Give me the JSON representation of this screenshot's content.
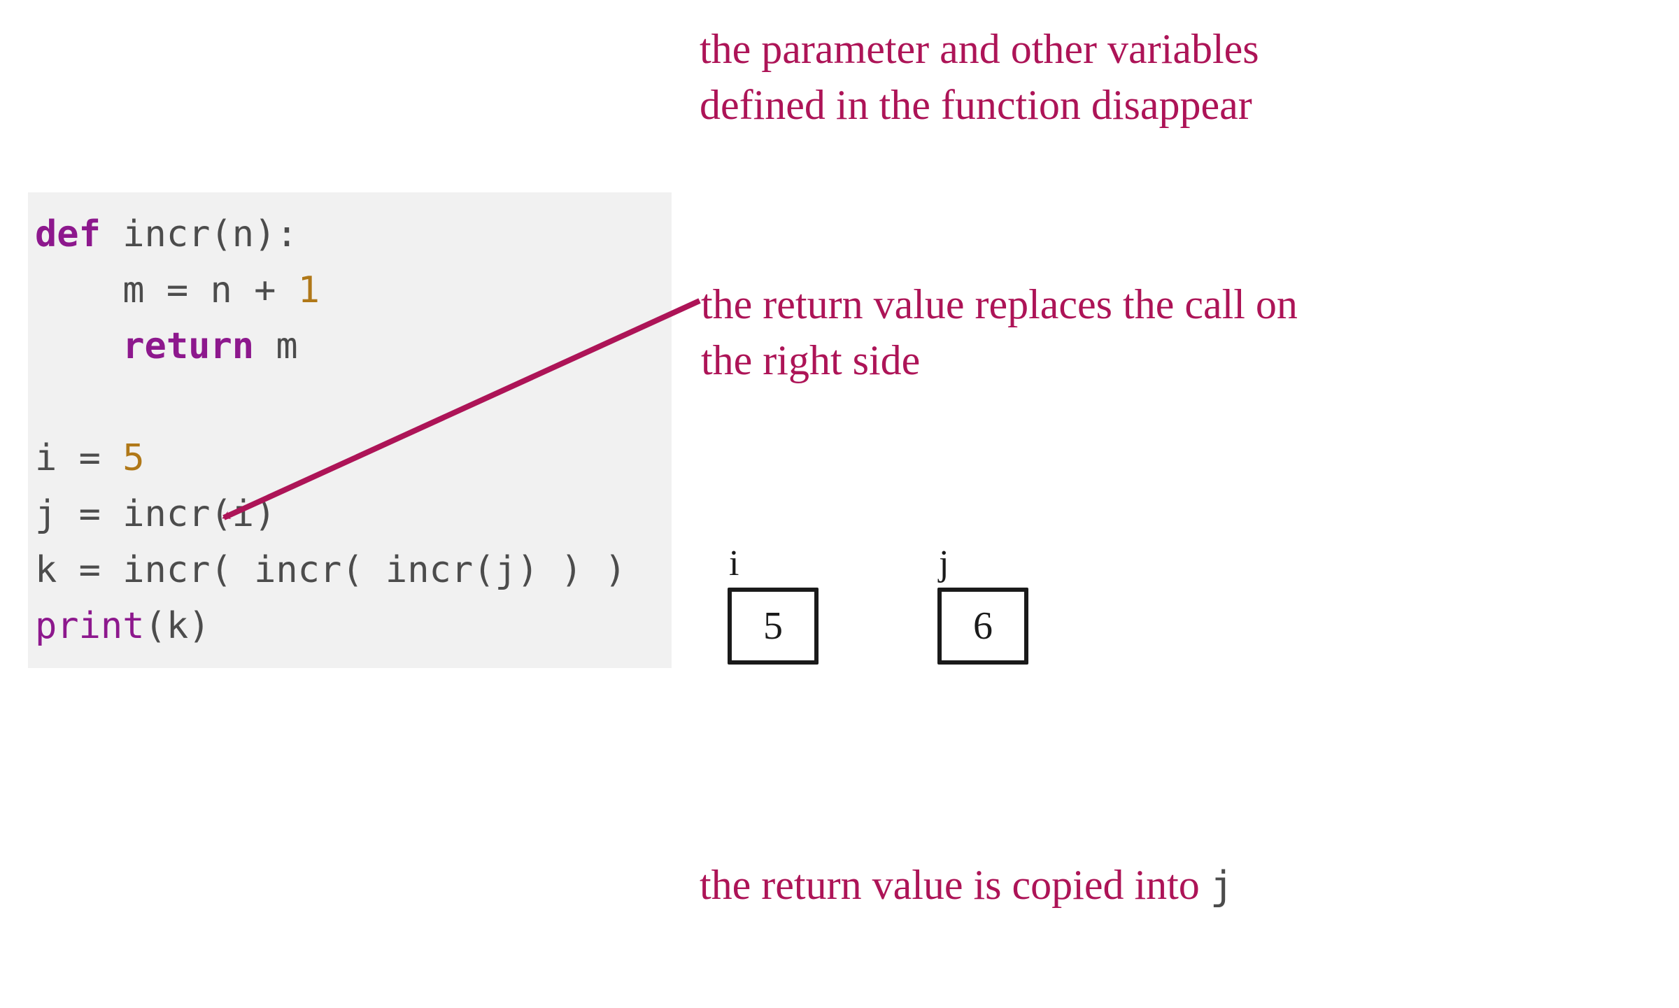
{
  "code": {
    "lines": [
      {
        "html": "<span class='t-def'>def</span> incr(n):"
      },
      {
        "html": "    m = n + <span class='t-num'>1</span>"
      },
      {
        "html": "    <span class='t-ret'>return</span> m"
      },
      {
        "html": ""
      },
      {
        "html": "i = <span class='t-num'>5</span>"
      },
      {
        "html": "j = incr(i)"
      },
      {
        "html": "k = incr( incr( incr(j) ) )"
      },
      {
        "html": "<span class='t-print'>print</span>(k)"
      }
    ]
  },
  "annotations": {
    "a1": "the parameter and other variables defined in the function disappear",
    "a2": "the return value replaces the call on the right side",
    "a3_pre": "the return value is copied into ",
    "a3_code": "j"
  },
  "variables": {
    "i": {
      "label": "i",
      "value": "5"
    },
    "j": {
      "label": "j",
      "value": "6"
    }
  },
  "colors": {
    "annotation_red": "#ad1457",
    "code_bg": "#f1f1f1",
    "keyword": "#8d188d",
    "number": "#b07818",
    "ink": "#1a1a1a",
    "code_text": "#4c4c4c"
  }
}
